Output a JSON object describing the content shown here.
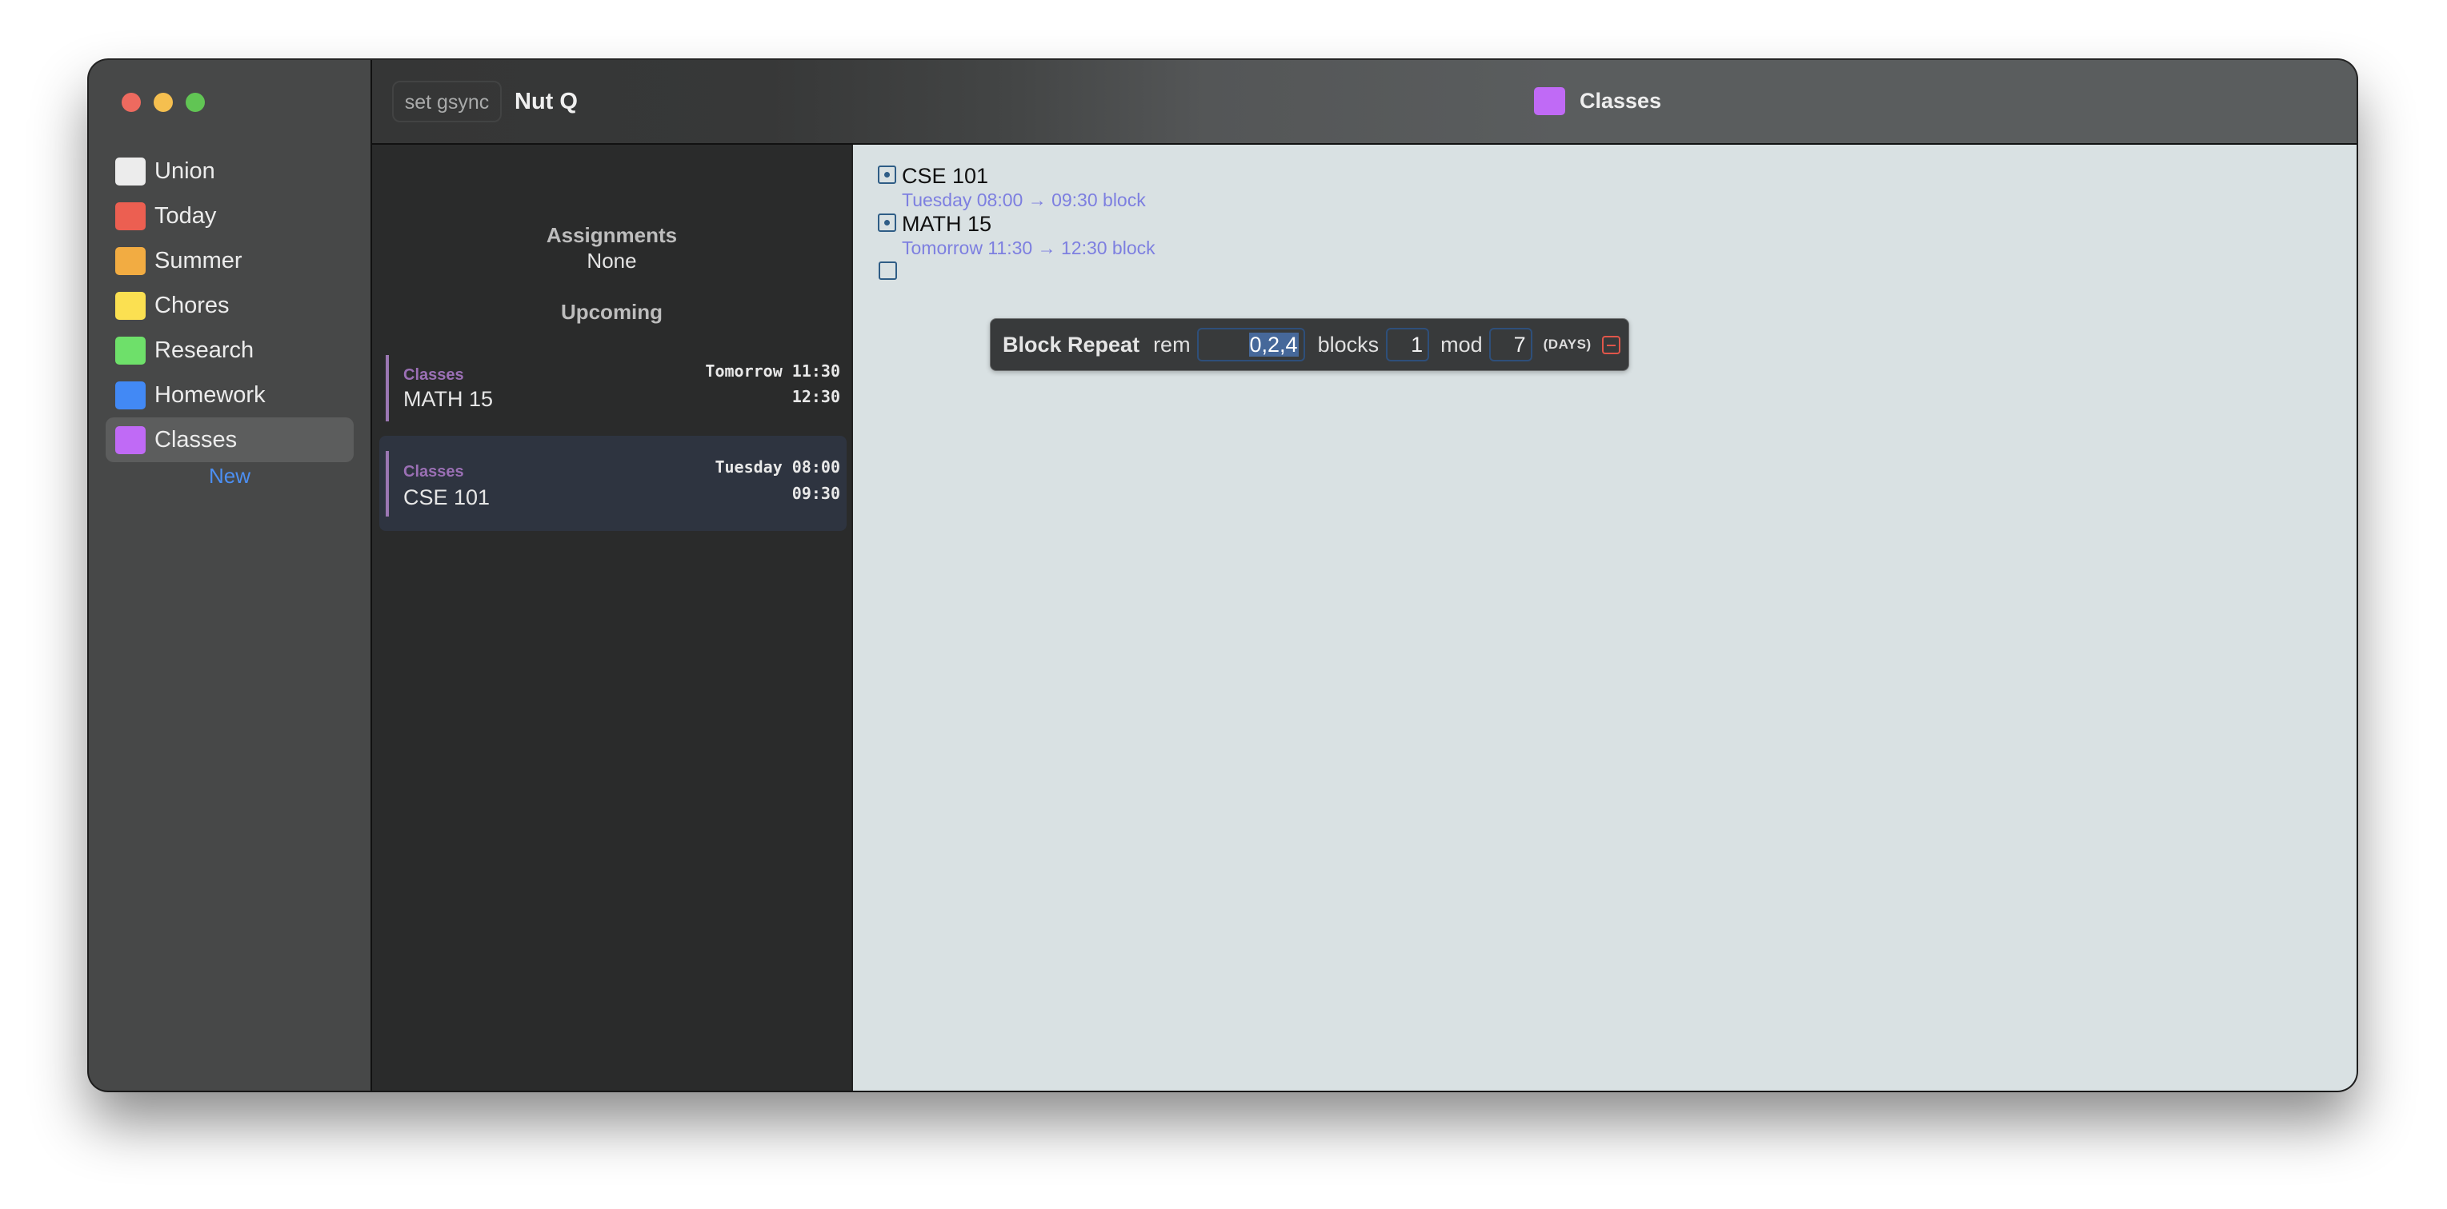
{
  "window": {
    "app_title": "Nut Q",
    "gsync_button": "set gsync",
    "current_list": {
      "label": "Classes",
      "color": "#c06af6"
    }
  },
  "sidebar": {
    "items": [
      {
        "label": "Union",
        "color": "#ececec",
        "selected": false
      },
      {
        "label": "Today",
        "color": "#ec5f51",
        "selected": false
      },
      {
        "label": "Summer",
        "color": "#f2ac42",
        "selected": false
      },
      {
        "label": "Chores",
        "color": "#fbe051",
        "selected": false
      },
      {
        "label": "Research",
        "color": "#6ee06a",
        "selected": false
      },
      {
        "label": "Homework",
        "color": "#4289f5",
        "selected": false
      },
      {
        "label": "Classes",
        "color": "#c06af6",
        "selected": true
      }
    ],
    "new_label": "New",
    "accent_color": "#4c8ff2"
  },
  "middle": {
    "assignments_heading": "Assignments",
    "assignments_value": "None",
    "upcoming_heading": "Upcoming",
    "upcoming": [
      {
        "list": "Classes",
        "name": "MATH 15",
        "start": "Tomorrow 11:30",
        "end": "12:30",
        "selected": false
      },
      {
        "list": "Classes",
        "name": "CSE 101",
        "start": "Tuesday 08:00",
        "end": "09:30",
        "selected": true
      }
    ]
  },
  "content": {
    "entries": [
      {
        "title": "CSE 101",
        "subtitle": "Tuesday 08:00 → 09:30 block",
        "state": "partial"
      },
      {
        "title": "MATH 15",
        "subtitle": "Tomorrow 11:30 → 12:30 block",
        "state": "partial"
      },
      {
        "title": "",
        "subtitle": "",
        "state": "unchecked"
      }
    ],
    "popup": {
      "title": "Block Repeat",
      "rem_label": "rem",
      "rem_value": "0,2,4",
      "blocks_label": "blocks",
      "blocks_value": "1",
      "mod_label": "mod",
      "mod_value": "7",
      "unit_label": "(DAYS)",
      "remove_icon": "minus-square-icon"
    }
  }
}
